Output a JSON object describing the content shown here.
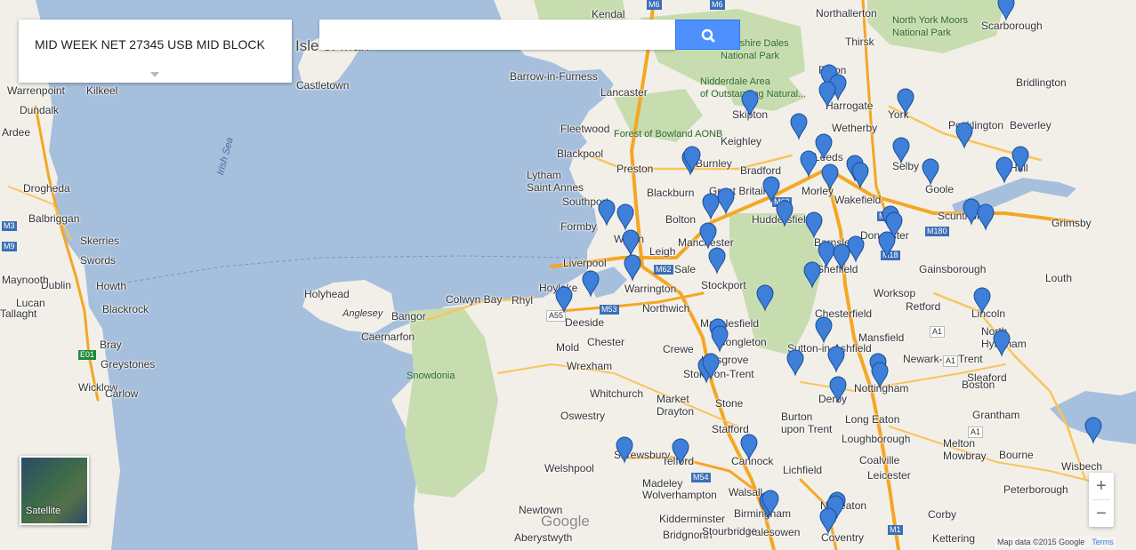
{
  "title_panel": {
    "text": "MID WEEK NET 27345 USB MID BLOCK"
  },
  "search": {
    "placeholder": "",
    "value": ""
  },
  "map_type": {
    "label": "Satellite"
  },
  "zoom": {
    "in_label": "+",
    "out_label": "−"
  },
  "attribution": {
    "text": "Map data ©2015 Google",
    "terms": "Terms"
  },
  "logo": {
    "text": "Google"
  },
  "colors": {
    "sea": "#a5bfdd",
    "land": "#f2efe9",
    "park": "#c7ddb0",
    "motorway": "#f5a623",
    "marker": "#3d7fd9"
  },
  "places": [
    {
      "name": "Kendal",
      "type": "city"
    },
    {
      "name": "Northallerton",
      "type": "city"
    },
    {
      "name": "Scarborough",
      "type": "city"
    },
    {
      "name": "North York Moors\nNational Park",
      "type": "park"
    },
    {
      "name": "Thirsk",
      "type": "city"
    },
    {
      "name": "Yorkshire Dales\nNational Park",
      "type": "park"
    },
    {
      "name": "Nidderdale Area\nof Outstanding Natural...",
      "type": "park"
    },
    {
      "name": "Isle of Man",
      "type": "island"
    },
    {
      "name": "Barrow-in-Furness",
      "type": "city"
    },
    {
      "name": "Lancaster",
      "type": "city"
    },
    {
      "name": "Ripon",
      "type": "city"
    },
    {
      "name": "Harrogate",
      "type": "city"
    },
    {
      "name": "York",
      "type": "city"
    },
    {
      "name": "Bridlington",
      "type": "city"
    },
    {
      "name": "Castletown",
      "type": "city"
    },
    {
      "name": "Skipton",
      "type": "city"
    },
    {
      "name": "Forest of Bowland AONB",
      "type": "park"
    },
    {
      "name": "Fleetwood",
      "type": "city"
    },
    {
      "name": "Keighley",
      "type": "city"
    },
    {
      "name": "Wetherby",
      "type": "city"
    },
    {
      "name": "Pocklington",
      "type": "city"
    },
    {
      "name": "Beverley",
      "type": "city"
    },
    {
      "name": "Blackpool",
      "type": "city"
    },
    {
      "name": "Preston",
      "type": "city"
    },
    {
      "name": "Burnley",
      "type": "city"
    },
    {
      "name": "Bradford",
      "type": "city"
    },
    {
      "name": "Leeds",
      "type": "city"
    },
    {
      "name": "Selby",
      "type": "city"
    },
    {
      "name": "Hull",
      "type": "city"
    },
    {
      "name": "Lytham\nSaint Annes",
      "type": "city"
    },
    {
      "name": "Blackburn",
      "type": "city"
    },
    {
      "name": "Great Britain",
      "type": "city"
    },
    {
      "name": "Morley",
      "type": "city"
    },
    {
      "name": "Wakefield",
      "type": "city"
    },
    {
      "name": "Goole",
      "type": "city"
    },
    {
      "name": "Southport",
      "type": "city"
    },
    {
      "name": "Bolton",
      "type": "city"
    },
    {
      "name": "Huddersfield",
      "type": "city"
    },
    {
      "name": "Doncaster",
      "type": "city"
    },
    {
      "name": "Scunthorpe",
      "type": "city"
    },
    {
      "name": "Grimsby",
      "type": "city"
    },
    {
      "name": "Formby",
      "type": "city"
    },
    {
      "name": "Wigan",
      "type": "city"
    },
    {
      "name": "Manchester",
      "type": "city"
    },
    {
      "name": "Barnsley",
      "type": "city"
    },
    {
      "name": "Leigh",
      "type": "city"
    },
    {
      "name": "Liverpool",
      "type": "city"
    },
    {
      "name": "Sale",
      "type": "city"
    },
    {
      "name": "Sheffield",
      "type": "city"
    },
    {
      "name": "Gainsborough",
      "type": "city"
    },
    {
      "name": "Louth",
      "type": "city"
    },
    {
      "name": "Warrington",
      "type": "city"
    },
    {
      "name": "Stockport",
      "type": "city"
    },
    {
      "name": "Worksop",
      "type": "city"
    },
    {
      "name": "Hoylake",
      "type": "city"
    },
    {
      "name": "Holyhead",
      "type": "city"
    },
    {
      "name": "Colwyn Bay",
      "type": "city"
    },
    {
      "name": "Rhyl",
      "type": "city"
    },
    {
      "name": "Northwich",
      "type": "city"
    },
    {
      "name": "Retford",
      "type": "city"
    },
    {
      "name": "Lincoln",
      "type": "city"
    },
    {
      "name": "Anglesey",
      "type": "island-small"
    },
    {
      "name": "Bangor",
      "type": "city"
    },
    {
      "name": "Deeside",
      "type": "city"
    },
    {
      "name": "Macclesfield",
      "type": "city"
    },
    {
      "name": "Chesterfield",
      "type": "city"
    },
    {
      "name": "North\nHykeham",
      "type": "city"
    },
    {
      "name": "Caernarfon",
      "type": "city"
    },
    {
      "name": "Chester",
      "type": "city"
    },
    {
      "name": "Congleton",
      "type": "city"
    },
    {
      "name": "Mansfield",
      "type": "city"
    },
    {
      "name": "Mold",
      "type": "city"
    },
    {
      "name": "Crewe",
      "type": "city"
    },
    {
      "name": "Sutton-in-Ashfield",
      "type": "city"
    },
    {
      "name": "Newark-on-Trent",
      "type": "city"
    },
    {
      "name": "Wrexham",
      "type": "city"
    },
    {
      "name": "Kidsgrove",
      "type": "city"
    },
    {
      "name": "Snowdonia",
      "type": "park"
    },
    {
      "name": "Stoke-on-Trent",
      "type": "city"
    },
    {
      "name": "Nottingham",
      "type": "city"
    },
    {
      "name": "Sleaford",
      "type": "city"
    },
    {
      "name": "Whitchurch",
      "type": "city"
    },
    {
      "name": "Derby",
      "type": "city"
    },
    {
      "name": "Boston",
      "type": "city"
    },
    {
      "name": "Market\nDrayton",
      "type": "city"
    },
    {
      "name": "Stone",
      "type": "city"
    },
    {
      "name": "Long Eaton",
      "type": "city"
    },
    {
      "name": "Burton\nupon Trent",
      "type": "city"
    },
    {
      "name": "Oswestry",
      "type": "city"
    },
    {
      "name": "Stafford",
      "type": "city"
    },
    {
      "name": "Grantham",
      "type": "city"
    },
    {
      "name": "Loughborough",
      "type": "city"
    },
    {
      "name": "Melton\nMowbray",
      "type": "city"
    },
    {
      "name": "Bourne",
      "type": "city"
    },
    {
      "name": "Shrewsbury",
      "type": "city"
    },
    {
      "name": "Telford",
      "type": "city"
    },
    {
      "name": "Cannock",
      "type": "city"
    },
    {
      "name": "Coalville",
      "type": "city"
    },
    {
      "name": "Wisbech",
      "type": "city"
    },
    {
      "name": "Welshpool",
      "type": "city"
    },
    {
      "name": "Madeley",
      "type": "city"
    },
    {
      "name": "Lichfield",
      "type": "city"
    },
    {
      "name": "Leicester",
      "type": "city"
    },
    {
      "name": "Wolverhampton",
      "type": "city"
    },
    {
      "name": "Walsall",
      "type": "city"
    },
    {
      "name": "Peterborough",
      "type": "city"
    },
    {
      "name": "Birmingham",
      "type": "city"
    },
    {
      "name": "Nuneaton",
      "type": "city"
    },
    {
      "name": "Newtown",
      "type": "city"
    },
    {
      "name": "Kidderminster",
      "type": "city"
    },
    {
      "name": "Halesowen",
      "type": "city"
    },
    {
      "name": "Corby",
      "type": "city"
    },
    {
      "name": "Bridgnorth",
      "type": "city"
    },
    {
      "name": "Stourbridge",
      "type": "city"
    },
    {
      "name": "Coventry",
      "type": "city"
    },
    {
      "name": "Aberystwyth",
      "type": "city"
    },
    {
      "name": "Kettering",
      "type": "city"
    },
    {
      "name": "Warrenpoint",
      "type": "city"
    },
    {
      "name": "Kilkeel",
      "type": "city"
    },
    {
      "name": "Dundalk",
      "type": "city"
    },
    {
      "name": "Ardee",
      "type": "city"
    },
    {
      "name": "Irish Sea",
      "type": "sea"
    },
    {
      "name": "Drogheda",
      "type": "city"
    },
    {
      "name": "Balbriggan",
      "type": "city"
    },
    {
      "name": "Skerries",
      "type": "city"
    },
    {
      "name": "Swords",
      "type": "city"
    },
    {
      "name": "Dublin",
      "type": "city"
    },
    {
      "name": "Howth",
      "type": "city"
    },
    {
      "name": "Maynooth",
      "type": "city"
    },
    {
      "name": "Lucan",
      "type": "city"
    },
    {
      "name": "Blackrock",
      "type": "city"
    },
    {
      "name": "Tallaght",
      "type": "city"
    },
    {
      "name": "Bray",
      "type": "city"
    },
    {
      "name": "Greystones",
      "type": "city"
    },
    {
      "name": "Wicklow",
      "type": "city"
    },
    {
      "name": "Carlow",
      "type": "city"
    }
  ],
  "road_labels": [
    "M6",
    "M62",
    "M62",
    "M53",
    "A55",
    "M1",
    "M18",
    "M180",
    "A1",
    "A1",
    "A1",
    "M54",
    "M1",
    "M6",
    "E01",
    "M3",
    "M9"
  ],
  "marker_count": 68
}
